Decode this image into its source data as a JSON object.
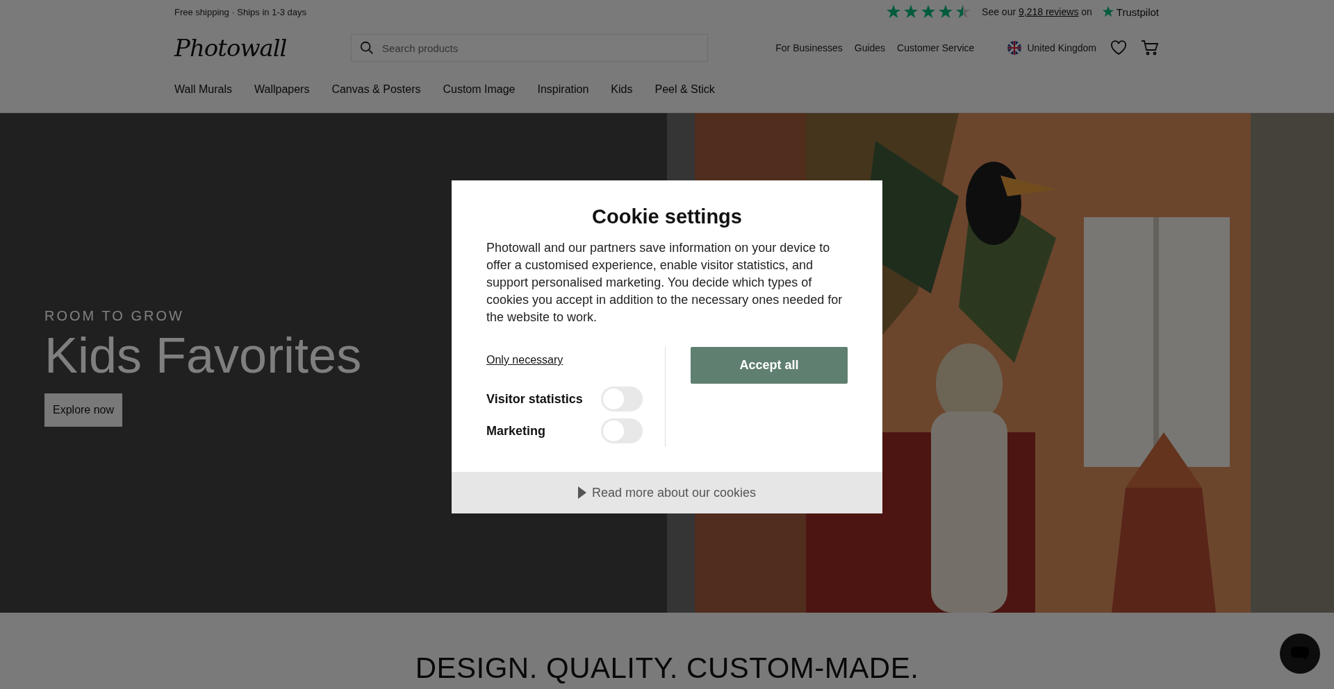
{
  "top_bar": {
    "shipping_text": "Free shipping · Ships in 1-3 days",
    "trustpilot": {
      "stars": 4.5,
      "text_before": "See our",
      "link": "9,218 reviews",
      "text_after": "on",
      "brand": "Trustpilot"
    }
  },
  "header": {
    "logo": "Photowall",
    "search": {
      "placeholder": "Search products"
    },
    "links": [
      "For Businesses",
      "Guides",
      "Customer Service"
    ],
    "region": "United Kingdom"
  },
  "nav": [
    "Wall Murals",
    "Wallpapers",
    "Canvas & Posters",
    "Custom Image",
    "Inspiration",
    "Kids",
    "Peel & Stick"
  ],
  "hero": {
    "eyebrow": "ROOM TO GROW",
    "title": "Kids Favorites",
    "button": "Explore now"
  },
  "section_heading": "DESIGN. QUALITY. CUSTOM-MADE.",
  "cookie_dialog": {
    "title": "Cookie settings",
    "body": "Photowall and our partners save information on your device to offer a customised experience, enable visitor statistics, and support personalised marketing. You decide which types of cookies you accept in addition to the necessary ones needed for the website to work.",
    "only_necessary": "Only necessary",
    "options": [
      {
        "label": "Visitor statistics",
        "checked": false
      },
      {
        "label": "Marketing",
        "checked": false
      }
    ],
    "accept": "Accept all",
    "read_more": "Read more about our cookies"
  }
}
